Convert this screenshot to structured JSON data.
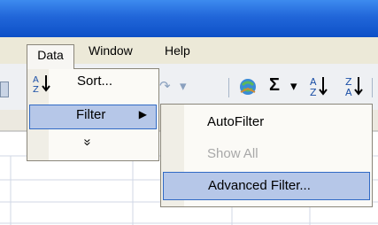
{
  "menubar": {
    "data": "Data",
    "window": "Window",
    "help": "Help"
  },
  "data_menu": {
    "sort_label": "Sort...",
    "filter_label": "Filter",
    "expand_label": "»"
  },
  "filter_submenu": {
    "autofilter_label": "AutoFilter",
    "show_all_label": "Show All",
    "advanced_filter_label": "Advanced Filter..."
  },
  "toolbar": {
    "sum_label": "Σ",
    "sort_asc_label": "A↓Z",
    "sort_desc_label": "Z↓A"
  },
  "colors": {
    "title_bar": "#2166d9",
    "highlight": "#b6c7e8",
    "highlight_border": "#316ac5"
  }
}
